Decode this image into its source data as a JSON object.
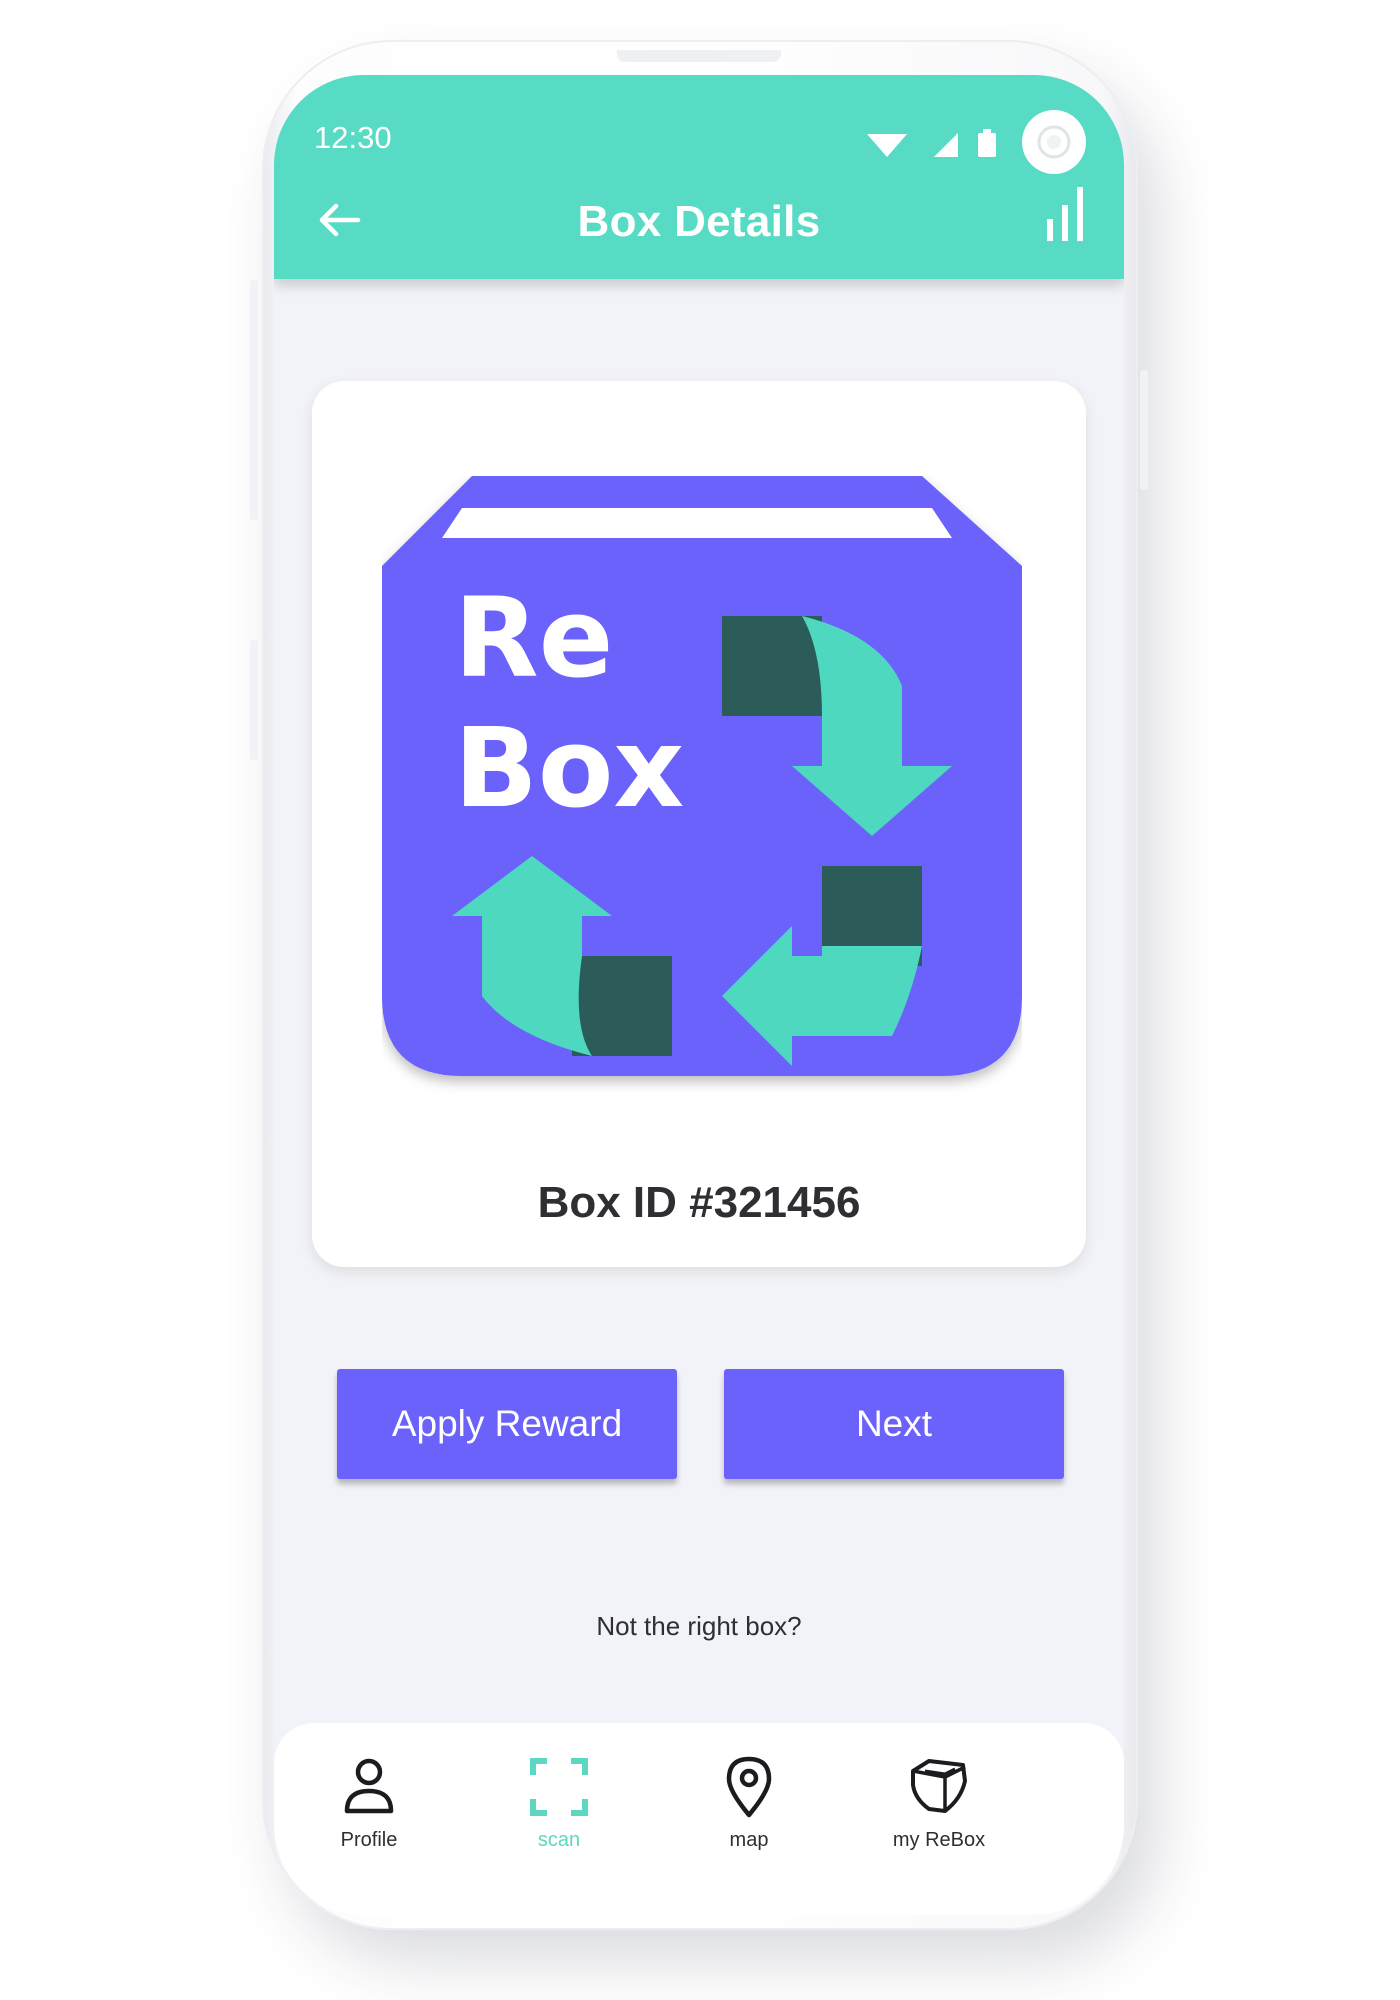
{
  "status_bar": {
    "time": "12:30"
  },
  "app_bar": {
    "title": "Box Details",
    "back_icon": "arrow-left-icon",
    "stats_icon": "bar-chart-icon"
  },
  "card": {
    "logo": {
      "line1": "Re",
      "line2": "Box"
    },
    "box_id": "Box ID #321456"
  },
  "actions": {
    "apply_reward": "Apply Reward",
    "next": "Next"
  },
  "not_right_box": "Not the right box?",
  "bottom_nav": {
    "active": "scan",
    "items": [
      {
        "label": "Profile",
        "icon": "user-icon"
      },
      {
        "label": "scan",
        "icon": "scan-icon"
      },
      {
        "label": "map",
        "icon": "map-pin-icon"
      },
      {
        "label": "my ReBox",
        "icon": "box-icon"
      }
    ]
  },
  "colors": {
    "app_bar": "#58dbc4",
    "primary": "#6a62fb",
    "logo_purple": "#6a62fb",
    "logo_teal": "#4ed8bf",
    "logo_dark": "#2b5c5a",
    "background": "#f2f3f8"
  }
}
